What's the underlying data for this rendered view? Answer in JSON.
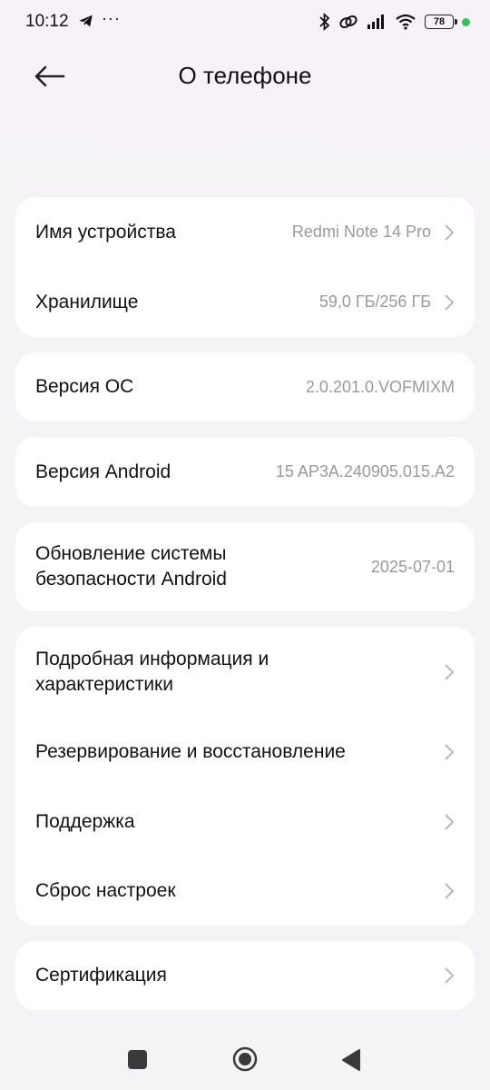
{
  "status_bar": {
    "time": "10:12",
    "battery": "78",
    "icons": [
      "telegram-icon",
      "more-dots-icon",
      "bluetooth-icon",
      "link-icon",
      "signal-icon",
      "wifi-icon",
      "battery-icon",
      "green-dot-indicator"
    ]
  },
  "header": {
    "title": "О телефоне",
    "back_icon": "arrow-left-icon"
  },
  "cards": {
    "device": {
      "rows": [
        {
          "label": "Имя устройства",
          "value": "Redmi Note 14 Pro"
        },
        {
          "label": "Хранилище",
          "value": "59,0 ГБ/256 ГБ"
        }
      ]
    },
    "os": {
      "label": "Версия ОС",
      "value": "2.0.201.0.VOFMIXM"
    },
    "android": {
      "label": "Версия Android",
      "value": "15 AP3A.240905.015.A2"
    },
    "security": {
      "label_line1": "Обновление системы",
      "label_line2": "безопасности Android",
      "value": "2025-07-01"
    },
    "more": {
      "rows": [
        {
          "label_line1": "Подробная информация и",
          "label_line2": "характеристики"
        },
        {
          "label": "Резервирование и восстановление"
        },
        {
          "label": "Поддержка"
        },
        {
          "label": "Сброс настроек"
        }
      ]
    },
    "cert": {
      "label": "Сертификация"
    }
  },
  "colors": {
    "background": "#f4f4f6",
    "card": "#ffffff",
    "value_text": "#9a9a9a",
    "chevron": "#b8b8b8",
    "indicator": "#33c35a"
  },
  "nav_bar": {
    "icons": [
      "recent-apps-square-icon",
      "home-circle-icon",
      "back-triangle-icon"
    ]
  }
}
